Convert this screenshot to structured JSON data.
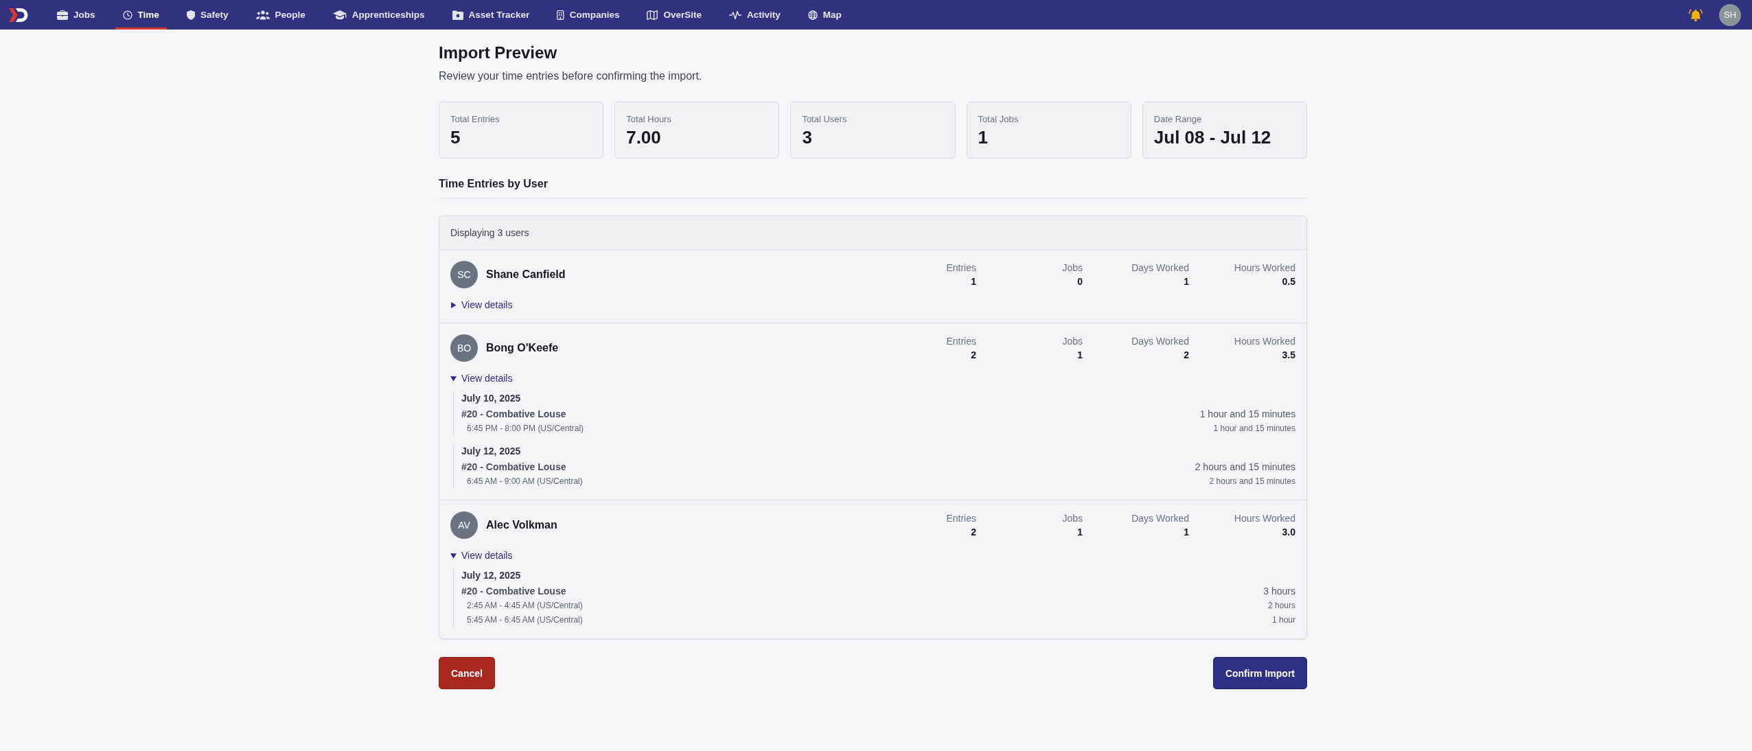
{
  "nav": {
    "items": [
      {
        "label": "Jobs",
        "selected": false
      },
      {
        "label": "Time",
        "selected": true
      },
      {
        "label": "Safety",
        "selected": false
      },
      {
        "label": "People",
        "selected": false
      },
      {
        "label": "Apprenticeships",
        "selected": false
      },
      {
        "label": "Asset Tracker",
        "selected": false
      },
      {
        "label": "Companies",
        "selected": false
      },
      {
        "label": "OverSite",
        "selected": false
      },
      {
        "label": "Activity",
        "selected": false
      },
      {
        "label": "Map",
        "selected": false
      }
    ],
    "account": {
      "initials": "SH"
    }
  },
  "page": {
    "title": "Import Preview",
    "subtitle": "Review your time entries before confirming the import."
  },
  "summary": [
    {
      "label": "Total Entries",
      "value": "5"
    },
    {
      "label": "Total Hours",
      "value": "7.00"
    },
    {
      "label": "Total Users",
      "value": "3"
    },
    {
      "label": "Total Jobs",
      "value": "1"
    },
    {
      "label": "Date Range",
      "value": "Jul 08 - Jul 12"
    }
  ],
  "section_title": "Time Entries by User",
  "users_panel": {
    "caption": "Displaying 3 users",
    "users": [
      {
        "initials": "SC",
        "name": "Shane Canfield",
        "stats": [
          {
            "label": "Entries",
            "value": "1"
          },
          {
            "label": "Jobs",
            "value": "0"
          },
          {
            "label": "Days Worked",
            "value": "1"
          },
          {
            "label": "Hours Worked",
            "value": "0.5"
          }
        ],
        "details_label": "View details",
        "expanded": false
      },
      {
        "initials": "BO",
        "name": "Bong O'Keefe",
        "stats": [
          {
            "label": "Entries",
            "value": "2"
          },
          {
            "label": "Jobs",
            "value": "1"
          },
          {
            "label": "Days Worked",
            "value": "2"
          },
          {
            "label": "Hours Worked",
            "value": "3.5"
          }
        ],
        "details_label": "View details",
        "expanded": true,
        "days": [
          {
            "date": "July 10, 2025",
            "jobs": [
              {
                "name": "#20 - Combative Louse",
                "duration": "1 hour and 15 minutes",
                "shifts": [
                  {
                    "time": "6:45 PM - 8:00 PM (US/Central)",
                    "duration": "1 hour and 15 minutes"
                  }
                ]
              }
            ]
          },
          {
            "date": "July 12, 2025",
            "jobs": [
              {
                "name": "#20 - Combative Louse",
                "duration": "2 hours and 15 minutes",
                "shifts": [
                  {
                    "time": "6:45 AM - 9:00 AM (US/Central)",
                    "duration": "2 hours and 15 minutes"
                  }
                ]
              }
            ]
          }
        ]
      },
      {
        "initials": "AV",
        "name": "Alec Volkman",
        "stats": [
          {
            "label": "Entries",
            "value": "2"
          },
          {
            "label": "Jobs",
            "value": "1"
          },
          {
            "label": "Days Worked",
            "value": "1"
          },
          {
            "label": "Hours Worked",
            "value": "3.0"
          }
        ],
        "details_label": "View details",
        "expanded": true,
        "days": [
          {
            "date": "July 12, 2025",
            "jobs": [
              {
                "name": "#20 - Combative Louse",
                "duration": "3 hours",
                "shifts": [
                  {
                    "time": "2:45 AM - 4:45 AM (US/Central)",
                    "duration": "2 hours"
                  },
                  {
                    "time": "5:45 AM - 6:45 AM (US/Central)",
                    "duration": "1 hour"
                  }
                ]
              }
            ]
          }
        ]
      }
    ]
  },
  "actions": [
    {
      "label": "Cancel",
      "kind": "danger"
    },
    {
      "label": "Confirm Import",
      "kind": "primary"
    }
  ]
}
